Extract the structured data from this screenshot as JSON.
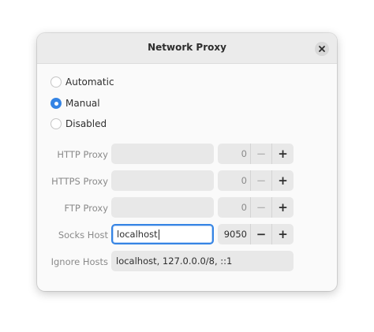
{
  "dialog": {
    "title": "Network Proxy"
  },
  "method": {
    "options": [
      {
        "label": "Automatic",
        "checked": false
      },
      {
        "label": "Manual",
        "checked": true
      },
      {
        "label": "Disabled",
        "checked": false
      }
    ]
  },
  "proxies": [
    {
      "label": "HTTP Proxy",
      "host": "",
      "port": "0"
    },
    {
      "label": "HTTPS Proxy",
      "host": "",
      "port": "0"
    },
    {
      "label": "FTP Proxy",
      "host": "",
      "port": "0"
    },
    {
      "label": "Socks Host",
      "host": "localhost",
      "port": "9050"
    }
  ],
  "ignore_hosts": {
    "label": "Ignore Hosts",
    "value": "localhost, 127.0.0.0/8, ::1"
  },
  "spin_symbols": {
    "minus": "−",
    "plus": "+"
  },
  "colors": {
    "accent": "#3584e4",
    "header": "#ebebeb",
    "entry_bg": "#e8e8e8"
  }
}
